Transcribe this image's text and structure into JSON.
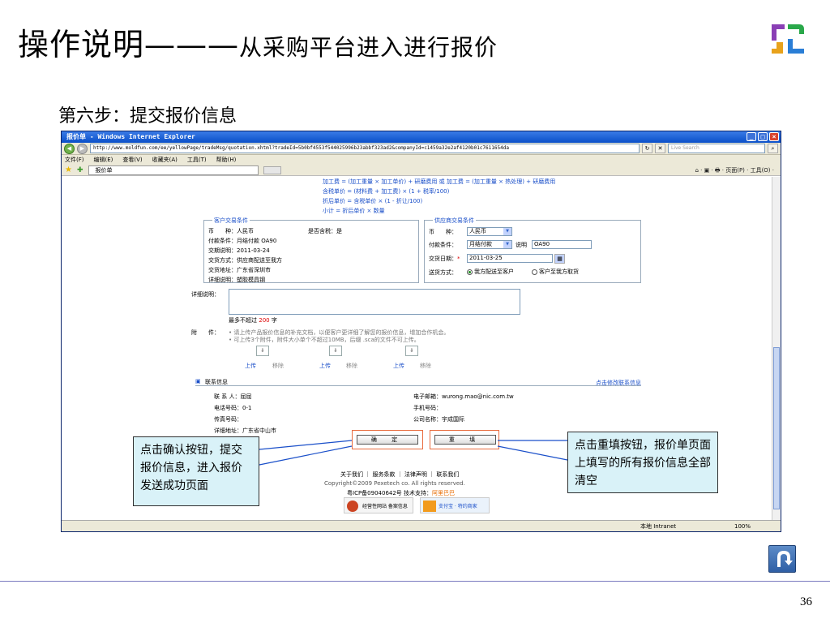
{
  "slide": {
    "title": "操作说明",
    "title_dash": "———",
    "title_sub": "从采购平台进入进行报价",
    "step": "第六步：提交报价信息",
    "page_number": "36"
  },
  "browser": {
    "window_title": "报价单 - Windows Internet Explorer",
    "url": "http://www.moldfun.com/ee/yellowPage/tradeMsg/quotation.xhtml?tradeId=5b0bf4553f544025996b23abbf323ad2&companyId=c1459a32e2af4120b01c7611654da",
    "search_placeholder": "Live Search",
    "menu": [
      "文件(F)",
      "编辑(E)",
      "查看(V)",
      "收藏夹(A)",
      "工具(T)",
      "帮助(H)"
    ],
    "tab_label": "报价单",
    "toolbar_right": "⌂ · ▣ · 🖶 · 页面(P) · 工具(O) ·",
    "status_zone": "本地 Intranet",
    "status_zoom": "100%"
  },
  "formulas": {
    "line1": "加工费 = (加工重量 × 加工单价) + 研磨费用 或 加工费 = (加工重量 × 热处理) + 研磨费用",
    "line2": "含税单价 = (材料费 + 加工费) × (1 + 税率/100)",
    "line3": "折后单价 = 含税单价 × (1 - 折让/100)",
    "line4": "小计 = 折后单价 × 数量"
  },
  "customer_terms": {
    "legend": "客户交易条件",
    "currency": "币　　种：人民币",
    "tax": "是否含税：是",
    "payment": "付款条件：月结付款 OA90",
    "delivery_date": "交期说明：2011-03-24",
    "shipping": "交货方式：供应商配送至我方",
    "address": "交货地址：广东省深圳市",
    "detail": "详细说明：塑胶模具钢"
  },
  "supplier_terms": {
    "legend": "供应商交易条件",
    "currency_label": "币　　种：",
    "currency_value": "人民币",
    "payment_label": "付款条件：",
    "payment_value": "月结付款",
    "note_label": "说明",
    "note_value": "OA90",
    "date_label": "交货日期：",
    "date_required": "*",
    "date_value": "2011-03-25",
    "shipping_label": "送货方式：",
    "shipping_option1": "我方配送至客户",
    "shipping_option2": "客户至我方取货"
  },
  "detail": {
    "label": "详细说明：",
    "limit_prefix": "最多不超过",
    "limit_num": "200",
    "limit_suffix": "字"
  },
  "attachments": {
    "label": "附　　件：",
    "note1": "• 请上传产品报价信息的补充文档，以便客户更详细了解您的报价信息，增加合作机会。",
    "note2": "• 可上传3个附件，附件大小单个不超过10MB，后缀 .sca的文件不可上传。",
    "upload_label": "上传",
    "remove_label": "移除",
    "box_glyph": "⇩"
  },
  "contact": {
    "heading": "联系信息",
    "modify_link": "点击修改联系信息",
    "name": "联 系 人：屈屈",
    "email": "电子邮箱：wurong.mao@nic.com.tw",
    "phone": "电话号码：0-1",
    "mobile": "手机号码：",
    "fax": "传真号码：",
    "company": "公司名称：宇成国际",
    "address": "详细地址：广东省中山市"
  },
  "buttons": {
    "confirm": "确 定",
    "reset": "重 填"
  },
  "footer": {
    "links": "关于我们 ｜ 服务条款 ｜ 法律声明 ｜ 联系我们",
    "copyright": "Copyright©2009 Pexetech co. All rights reserved.",
    "icp_prefix": "粤ICP备09040642号 技术支持：",
    "icp_company": "阿里巴巴",
    "badge1": "经营性网站 备案信息",
    "badge2": "支付宝 · 特约商家"
  },
  "callouts": {
    "left": "点击确认按钮，提交报价信息，进入报价发送成功页面",
    "right": "点击重填按钮，报价单页面上填写的所有报价信息全部清空"
  },
  "colors": {
    "accent_blue": "#1a4fc9",
    "callout_bg": "#d9f2f8",
    "highlight_orange": "#e86b3e"
  }
}
